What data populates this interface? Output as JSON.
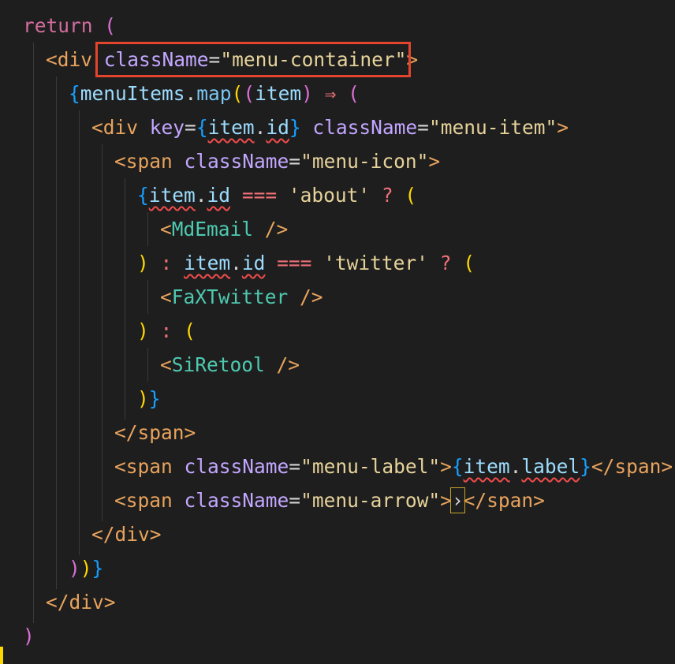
{
  "editor": {
    "language": "jsx",
    "highlight_note": "className=\"menu-container\"",
    "lines": [
      {
        "indent": 1,
        "tokens": [
          [
            "kw",
            "return"
          ],
          [
            "pun",
            " "
          ],
          [
            "br2",
            "("
          ]
        ]
      },
      {
        "indent": 2,
        "tokens": [
          [
            "tag",
            "<div"
          ],
          [
            "pun",
            " "
          ],
          [
            "attr",
            "className"
          ],
          [
            "eq",
            "="
          ],
          [
            "str",
            "\"menu-container\""
          ],
          [
            "tag",
            ">"
          ]
        ]
      },
      {
        "indent": 3,
        "tokens": [
          [
            "br3",
            "{"
          ],
          [
            "var",
            "menuItems"
          ],
          [
            "pun",
            "."
          ],
          [
            "fn",
            "map"
          ],
          [
            "br1",
            "("
          ],
          [
            "br2",
            "("
          ],
          [
            "var",
            "item"
          ],
          [
            "br2",
            ")"
          ],
          [
            "pun",
            " "
          ],
          [
            "op",
            "⇒"
          ],
          [
            "pun",
            " "
          ],
          [
            "br2",
            "("
          ]
        ]
      },
      {
        "indent": 4,
        "tokens": [
          [
            "tag",
            "<div"
          ],
          [
            "pun",
            " "
          ],
          [
            "attr",
            "key"
          ],
          [
            "eq",
            "="
          ],
          [
            "br3",
            "{"
          ],
          [
            "varsq",
            "item"
          ],
          [
            "pun",
            "."
          ],
          [
            "varsq",
            "id"
          ],
          [
            "br3",
            "}"
          ],
          [
            "pun",
            " "
          ],
          [
            "attr",
            "className"
          ],
          [
            "eq",
            "="
          ],
          [
            "str",
            "\"menu-item\""
          ],
          [
            "tag",
            ">"
          ]
        ]
      },
      {
        "indent": 5,
        "tokens": [
          [
            "tag",
            "<span"
          ],
          [
            "pun",
            " "
          ],
          [
            "attr",
            "className"
          ],
          [
            "eq",
            "="
          ],
          [
            "str",
            "\"menu-icon\""
          ],
          [
            "tag",
            ">"
          ]
        ]
      },
      {
        "indent": 6,
        "tokens": [
          [
            "br3",
            "{"
          ],
          [
            "varsq",
            "item"
          ],
          [
            "pun",
            "."
          ],
          [
            "varsq",
            "id"
          ],
          [
            "pun",
            " "
          ],
          [
            "op",
            "==="
          ],
          [
            "pun",
            " "
          ],
          [
            "str",
            "'about'"
          ],
          [
            "pun",
            " "
          ],
          [
            "op",
            "?"
          ],
          [
            "pun",
            " "
          ],
          [
            "br1",
            "("
          ]
        ]
      },
      {
        "indent": 7,
        "tokens": [
          [
            "tag",
            "<"
          ],
          [
            "comp",
            "MdEmail"
          ],
          [
            "pun",
            " "
          ],
          [
            "tag",
            "/>"
          ]
        ]
      },
      {
        "indent": 6,
        "tokens": [
          [
            "br1",
            ")"
          ],
          [
            "pun",
            " "
          ],
          [
            "op",
            ":"
          ],
          [
            "pun",
            " "
          ],
          [
            "varsq",
            "item"
          ],
          [
            "pun",
            "."
          ],
          [
            "varsq",
            "id"
          ],
          [
            "pun",
            " "
          ],
          [
            "op",
            "==="
          ],
          [
            "pun",
            " "
          ],
          [
            "str",
            "'twitter'"
          ],
          [
            "pun",
            " "
          ],
          [
            "op",
            "?"
          ],
          [
            "pun",
            " "
          ],
          [
            "br1",
            "("
          ]
        ]
      },
      {
        "indent": 7,
        "tokens": [
          [
            "tag",
            "<"
          ],
          [
            "comp",
            "FaXTwitter"
          ],
          [
            "pun",
            " "
          ],
          [
            "tag",
            "/>"
          ]
        ]
      },
      {
        "indent": 6,
        "tokens": [
          [
            "br1",
            ")"
          ],
          [
            "pun",
            " "
          ],
          [
            "op",
            ":"
          ],
          [
            "pun",
            " "
          ],
          [
            "br1",
            "("
          ]
        ]
      },
      {
        "indent": 7,
        "tokens": [
          [
            "tag",
            "<"
          ],
          [
            "comp",
            "SiRetool"
          ],
          [
            "pun",
            " "
          ],
          [
            "tag",
            "/>"
          ]
        ]
      },
      {
        "indent": 6,
        "tokens": [
          [
            "br1",
            ")"
          ],
          [
            "br3",
            "}"
          ]
        ]
      },
      {
        "indent": 5,
        "tokens": [
          [
            "tag",
            "</span>"
          ]
        ]
      },
      {
        "indent": 5,
        "tokens": [
          [
            "tag",
            "<span"
          ],
          [
            "pun",
            " "
          ],
          [
            "attr",
            "className"
          ],
          [
            "eq",
            "="
          ],
          [
            "str",
            "\"menu-label\""
          ],
          [
            "tag",
            ">"
          ],
          [
            "br3",
            "{"
          ],
          [
            "varsq",
            "item"
          ],
          [
            "pun",
            "."
          ],
          [
            "varsq",
            "label"
          ],
          [
            "br3",
            "}"
          ],
          [
            "tag",
            "</span>"
          ]
        ]
      },
      {
        "indent": 5,
        "tokens": [
          [
            "tag",
            "<span"
          ],
          [
            "pun",
            " "
          ],
          [
            "attr",
            "className"
          ],
          [
            "eq",
            "="
          ],
          [
            "str",
            "\"menu-arrow\""
          ],
          [
            "tag",
            ">"
          ],
          [
            "cursor",
            "›"
          ],
          [
            "tag",
            "</span>"
          ]
        ]
      },
      {
        "indent": 4,
        "tokens": [
          [
            "tag",
            "</div>"
          ]
        ]
      },
      {
        "indent": 3,
        "tokens": [
          [
            "br2",
            ")"
          ],
          [
            "br1",
            ")"
          ],
          [
            "br3",
            "}"
          ]
        ]
      },
      {
        "indent": 2,
        "tokens": [
          [
            "tag",
            "</div>"
          ]
        ]
      },
      {
        "indent": 1,
        "tokens": [
          [
            "br2",
            ")"
          ]
        ]
      }
    ]
  },
  "colors": {
    "background": "#1e1e1e",
    "highlight_border": "#e2452b",
    "squiggle": "#f14c4c",
    "cursor_border": "#c9a227"
  }
}
